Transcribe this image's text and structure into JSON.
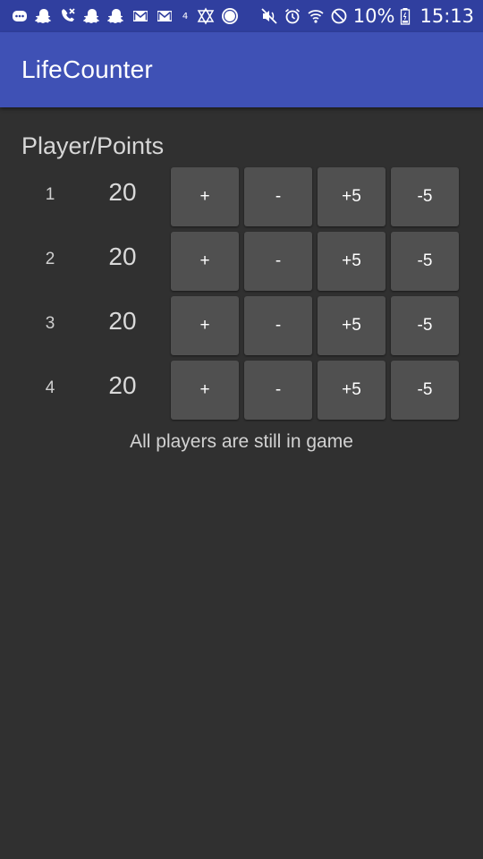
{
  "status_bar": {
    "network_type": "4",
    "battery_percent": "10%",
    "time": "15:13",
    "icons_left": [
      "messages-icon",
      "snapchat-icon",
      "missed-call-icon",
      "snapchat-icon",
      "snapchat-icon",
      "gmail-icon",
      "gmail-icon",
      "network-4g-icon",
      "triangle-app-icon",
      "naver-toon-icon"
    ],
    "icons_right": [
      "mute-icon",
      "alarm-icon",
      "wifi-icon",
      "do-not-disturb-icon",
      "battery-icon"
    ]
  },
  "app_bar": {
    "title": "LifeCounter",
    "color": "#3f51b5",
    "status_color": "#303f9f"
  },
  "main": {
    "header": "Player/Points",
    "buttons": {
      "plus": "+",
      "minus": "-",
      "plus5": "+5",
      "minus5": "-5"
    },
    "players": [
      {
        "number": "1",
        "points": "20"
      },
      {
        "number": "2",
        "points": "20"
      },
      {
        "number": "3",
        "points": "20"
      },
      {
        "number": "4",
        "points": "20"
      }
    ],
    "status_message": "All players are still in game"
  }
}
